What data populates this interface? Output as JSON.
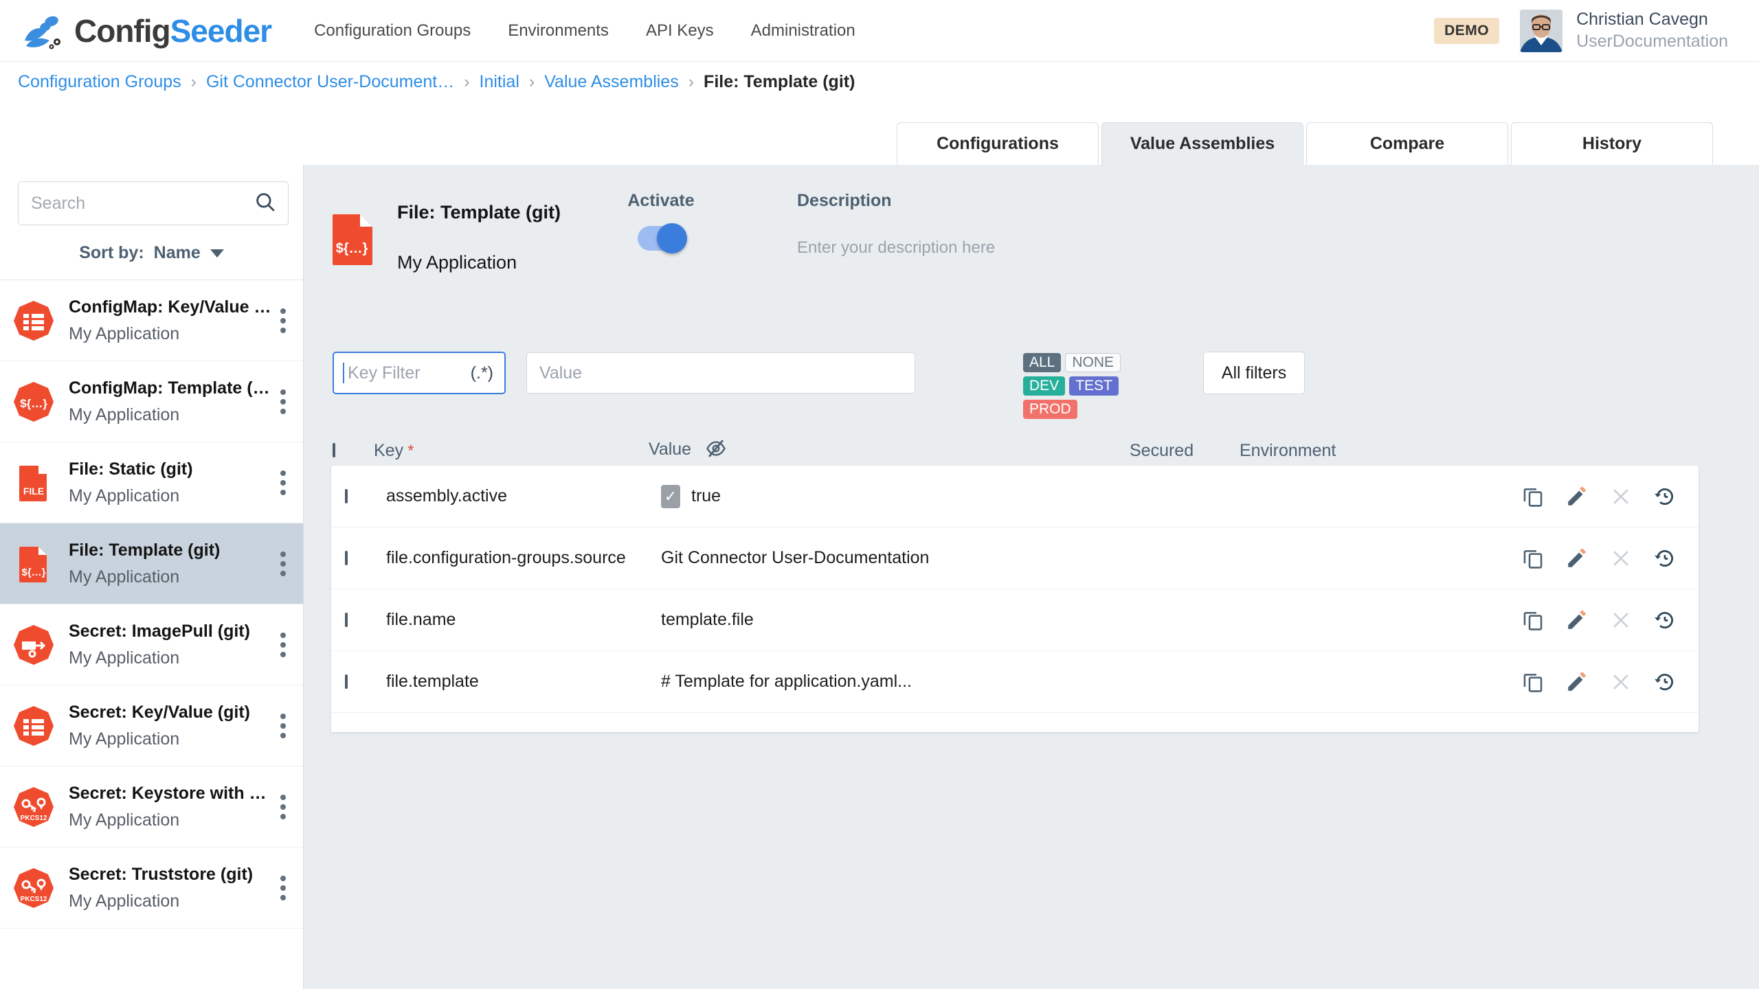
{
  "brand": {
    "name_first": "Config",
    "name_second": "Seeder",
    "logo_icon": "configseeder-logo-icon"
  },
  "topnav": [
    {
      "label": "Configuration Groups"
    },
    {
      "label": "Environments"
    },
    {
      "label": "API Keys"
    },
    {
      "label": "Administration"
    }
  ],
  "account": {
    "badge": "DEMO",
    "name": "Christian Cavegn",
    "tenant": "UserDocumentation"
  },
  "breadcrumb": [
    {
      "label": "Configuration Groups",
      "current": false
    },
    {
      "label": "Git Connector User-Document…",
      "current": false
    },
    {
      "label": "Initial",
      "current": false
    },
    {
      "label": "Value Assemblies",
      "current": false
    },
    {
      "label": "File: Template (git)",
      "current": true
    }
  ],
  "breadcrumb_separator": "›",
  "tabs": [
    {
      "label": "Configurations",
      "active": false
    },
    {
      "label": "Value Assemblies",
      "active": true
    },
    {
      "label": "Compare",
      "active": false
    },
    {
      "label": "History",
      "active": false
    }
  ],
  "sidebar": {
    "search": {
      "placeholder": "Search",
      "value": "",
      "icon": "search-icon"
    },
    "add_icon": "plus-icon",
    "sort": {
      "label": "Sort by:",
      "value": "Name",
      "icon": "chevron-down-icon"
    },
    "items": [
      {
        "title": "ConfigMap: Key/Value …",
        "subtitle": "My Application",
        "icon": "configmap-keyvalue-icon",
        "selected": false
      },
      {
        "title": "ConfigMap: Template (…",
        "subtitle": "My Application",
        "icon": "configmap-template-icon",
        "selected": false
      },
      {
        "title": "File: Static (git)",
        "subtitle": "My Application",
        "icon": "file-static-icon",
        "selected": false
      },
      {
        "title": "File: Template (git)",
        "subtitle": "My Application",
        "icon": "file-template-icon",
        "selected": true
      },
      {
        "title": "Secret: ImagePull (git)",
        "subtitle": "My Application",
        "icon": "secret-imagepull-icon",
        "selected": false
      },
      {
        "title": "Secret: Key/Value (git)",
        "subtitle": "My Application",
        "icon": "secret-keyvalue-icon",
        "selected": false
      },
      {
        "title": "Secret: Keystore with …",
        "subtitle": "My Application",
        "icon": "secret-keystore-icon",
        "selected": false
      },
      {
        "title": "Secret: Truststore (git)",
        "subtitle": "My Application",
        "icon": "secret-truststore-icon",
        "selected": false
      }
    ]
  },
  "detail": {
    "icon": "file-template-icon",
    "title": "File: Template (git)",
    "subtitle": "My Application",
    "activate_label": "Activate",
    "activate_on": true,
    "description_label": "Description",
    "description_placeholder": "Enter your description here",
    "description_value": ""
  },
  "filters": {
    "key_filter": {
      "placeholder": "Key Filter",
      "value": "",
      "regex_hint": "(.*)",
      "focused": true
    },
    "value_filter": {
      "placeholder": "Value",
      "value": ""
    },
    "env_tags": [
      {
        "label": "ALL",
        "style": "all",
        "color": "#5c7080"
      },
      {
        "label": "NONE",
        "style": "none",
        "color": "#fafbfc"
      },
      {
        "label": "DEV",
        "style": "dev",
        "color": "#26b09a"
      },
      {
        "label": "TEST",
        "style": "test",
        "color": "#6470cf"
      },
      {
        "label": "PROD",
        "style": "prod",
        "color": "#f1726b"
      }
    ],
    "all_filters_label": "All filters"
  },
  "table": {
    "columns": {
      "key": "Key",
      "key_required_marker": "*",
      "value": "Value",
      "value_visibility_icon": "eye-off-icon",
      "secured": "Secured",
      "environment": "Environment"
    },
    "select_all_checked": false,
    "rows": [
      {
        "checked": false,
        "key": "assembly.active",
        "value": "true",
        "value_is_checkbox": true,
        "value_checkbox_checked": true,
        "secured": "",
        "environment": ""
      },
      {
        "checked": false,
        "key": "file.configuration-groups.source",
        "value": "Git Connector User-Documentation",
        "value_is_checkbox": false,
        "secured": "",
        "environment": ""
      },
      {
        "checked": false,
        "key": "file.name",
        "value": "template.file",
        "value_is_checkbox": false,
        "secured": "",
        "environment": ""
      },
      {
        "checked": false,
        "key": "file.template",
        "value": "# Template for application.yaml...",
        "value_is_checkbox": false,
        "secured": "",
        "environment": ""
      }
    ],
    "row_actions": [
      {
        "name": "copy-icon",
        "label": "Copy",
        "disabled": false
      },
      {
        "name": "edit-icon",
        "label": "Edit",
        "disabled": false
      },
      {
        "name": "delete-icon",
        "label": "Delete",
        "disabled": true
      },
      {
        "name": "history-icon",
        "label": "History",
        "disabled": false
      }
    ]
  }
}
